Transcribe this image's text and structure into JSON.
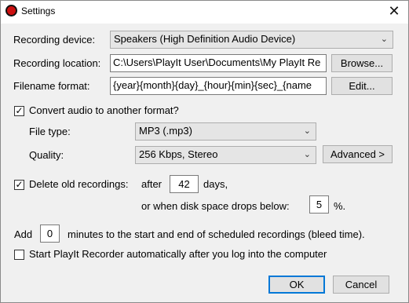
{
  "window": {
    "title": "Settings",
    "close_glyph": "✕"
  },
  "recording": {
    "device_label": "Recording device:",
    "device_value": "Speakers (High Definition Audio Device)",
    "location_label": "Recording location:",
    "location_value": "C:\\Users\\PlayIt User\\Documents\\My PlayIt Re",
    "browse_label": "Browse...",
    "filename_label": "Filename format:",
    "filename_value": "{year}{month}{day}_{hour}{min}{sec}_{name",
    "edit_label": "Edit..."
  },
  "convert": {
    "checkbox_label": "Convert audio to another format?",
    "checked": true,
    "filetype_label": "File type:",
    "filetype_value": "MP3 (.mp3)",
    "quality_label": "Quality:",
    "quality_value": "256 Kbps, Stereo",
    "advanced_label": "Advanced >"
  },
  "delete": {
    "checkbox_label": "Delete old recordings:",
    "checked": true,
    "after_label": "after",
    "days_value": "42",
    "days_label": "days,",
    "disk_label": "or when disk space drops below:",
    "percent_value": "5",
    "percent_label": "%."
  },
  "bleed": {
    "add_label": "Add",
    "minutes_value": "0",
    "suffix_label": "minutes to the start and end of scheduled recordings (bleed time)."
  },
  "autostart": {
    "checkbox_label": "Start PlayIt Recorder automatically after you log into the computer",
    "checked": false
  },
  "footer": {
    "ok_label": "OK",
    "cancel_label": "Cancel"
  },
  "colors": {
    "accent": "#0078d7",
    "app_icon": "#cc1010"
  },
  "icons": {
    "chevron": "⌄",
    "check": "✓"
  }
}
